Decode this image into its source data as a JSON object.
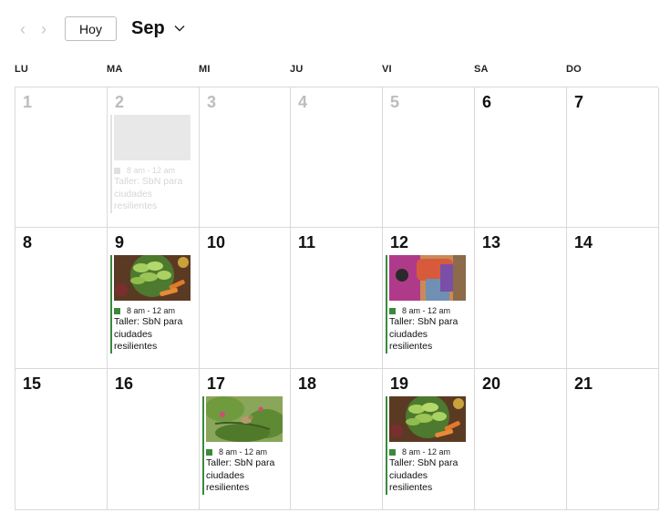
{
  "toolbar": {
    "prev_icon": "chevron-left-icon",
    "next_icon": "chevron-right-icon",
    "today_label": "Hoy",
    "month_label": "Sep",
    "month_dropdown_icon": "chevron-down-icon"
  },
  "weekdays": [
    "LU",
    "MA",
    "MI",
    "JU",
    "VI",
    "SA",
    "DO"
  ],
  "weeks": [
    [
      {
        "day": "1",
        "muted": true
      },
      {
        "day": "2",
        "muted": true,
        "event": {
          "time": "8 am - 12 am",
          "title": "Taller: SbN para ciudades resilientes",
          "image": "placeholder",
          "faded": true
        }
      },
      {
        "day": "3",
        "muted": true
      },
      {
        "day": "4",
        "muted": true
      },
      {
        "day": "5",
        "muted": true
      },
      {
        "day": "6"
      },
      {
        "day": "7"
      }
    ],
    [
      {
        "day": "8"
      },
      {
        "day": "9",
        "event": {
          "time": "8 am - 12 am",
          "title": "Taller: SbN para ciudades resilientes",
          "image": "vegetables-photo"
        }
      },
      {
        "day": "10"
      },
      {
        "day": "11"
      },
      {
        "day": "12",
        "event": {
          "time": "8 am - 12 am",
          "title": "Taller: SbN para ciudades resilientes",
          "image": "people-photo"
        }
      },
      {
        "day": "13"
      },
      {
        "day": "14"
      }
    ],
    [
      {
        "day": "15"
      },
      {
        "day": "16"
      },
      {
        "day": "17",
        "event": {
          "time": "8 am - 12 am",
          "title": "Taller: SbN para ciudades resilientes",
          "image": "bird-photo"
        }
      },
      {
        "day": "18"
      },
      {
        "day": "19",
        "event": {
          "time": "8 am - 12 am",
          "title": "Taller: SbN para ciudades resilientes",
          "image": "vegetables-photo"
        }
      },
      {
        "day": "20"
      },
      {
        "day": "21"
      }
    ]
  ],
  "colors": {
    "event_accent": "#3b8a3b",
    "muted_text": "#bdbdbd",
    "grid_line": "#d9d9d9"
  }
}
